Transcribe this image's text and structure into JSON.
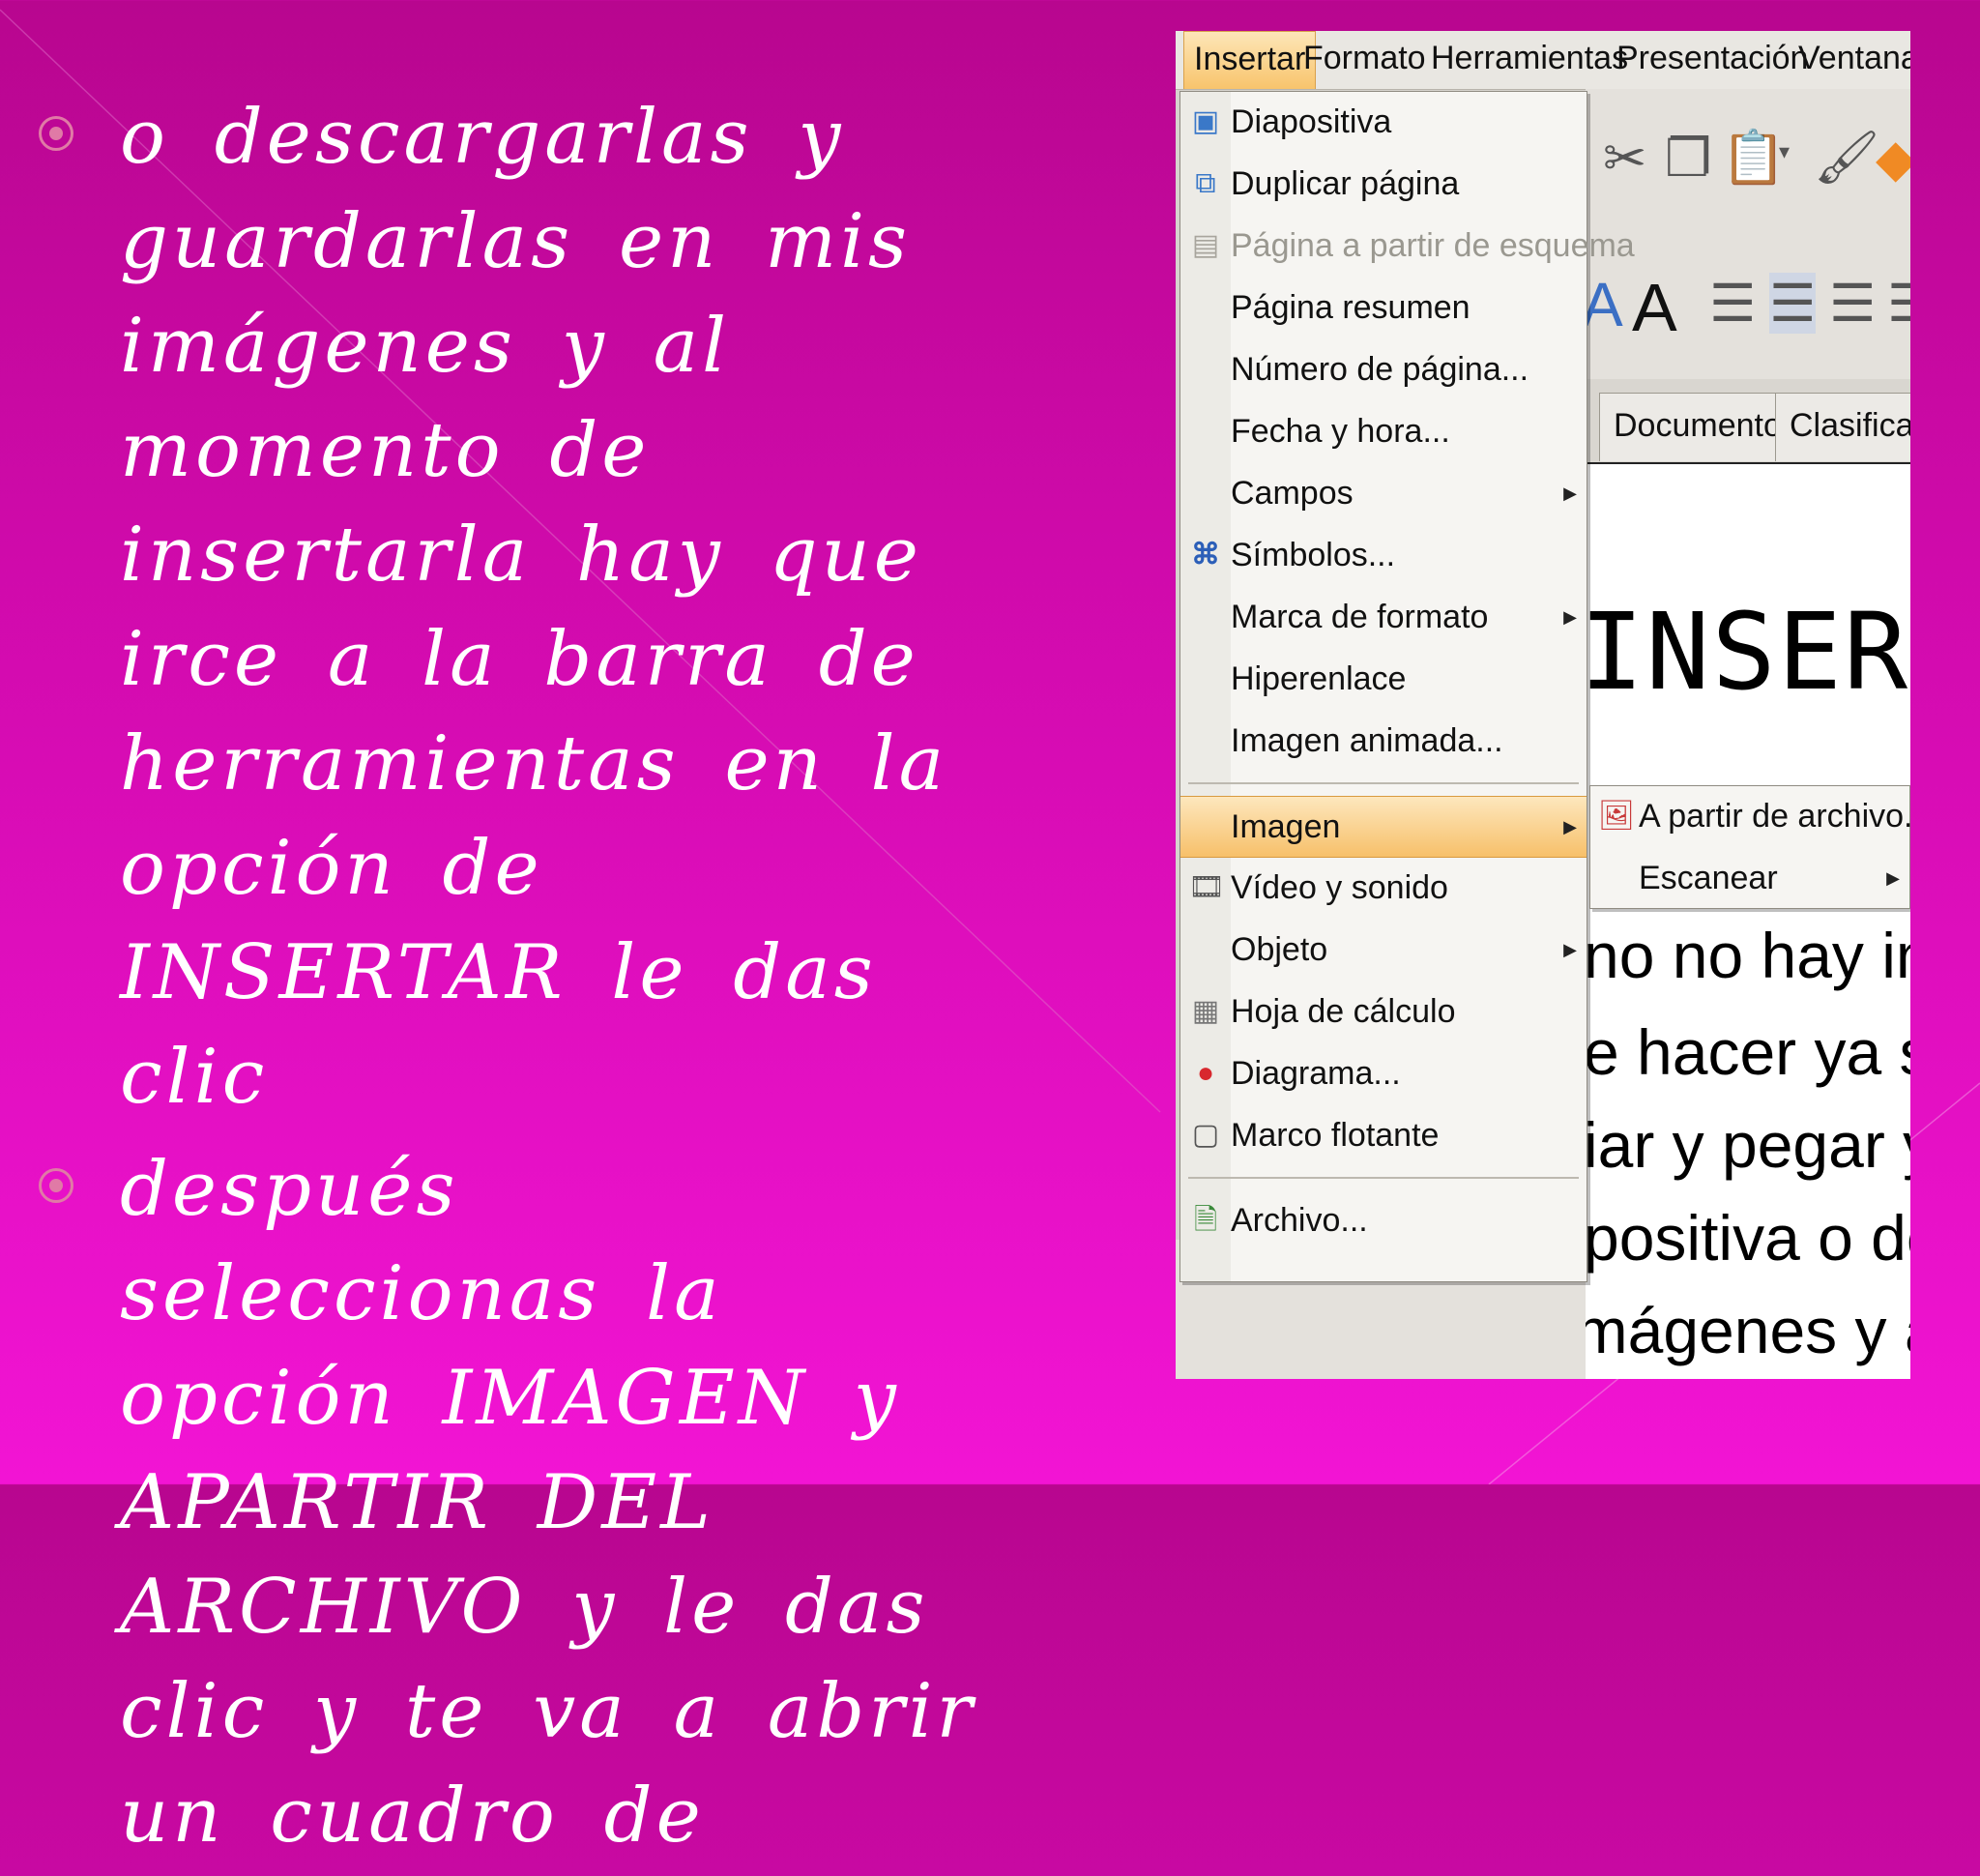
{
  "slide": {
    "bullets": [
      {
        "text": "o descargarlas y guardarlas en mis imágenes y al momento de insertarla hay que irce a la barra de herramientas en la opción de INSERTAR le das clic"
      },
      {
        "text": "después seleccionas la opción IMAGEN y APARTIR DEL ARCHIVO y le das clic y te va a abrir un cuadro de"
      }
    ]
  },
  "screenshot": {
    "menubar": [
      "Insertar",
      "Formato",
      "Herramientas",
      "Presentación",
      "Ventana"
    ],
    "active_menu": "Insertar",
    "tabs": [
      "Documento",
      "Clasificac"
    ],
    "document": {
      "heading": "INSERCIÓ",
      "lines": [
        "no no hay imáge",
        "e hacer ya sea l",
        "iar y pegar y as",
        "positiva o desca",
        "imágenes y al mome"
      ]
    },
    "insert_menu": {
      "items": [
        {
          "label": "Diapositiva",
          "icon": "slide-icon"
        },
        {
          "label": "Duplicar página",
          "icon": "duplicate-page-icon"
        },
        {
          "label": "Página a partir de esquema",
          "icon": "outline-page-icon",
          "disabled": true
        },
        {
          "label": "Página resumen"
        },
        {
          "label": "Número de página..."
        },
        {
          "label": "Fecha y hora..."
        },
        {
          "label": "Campos",
          "submenu": true
        },
        {
          "label": "Símbolos...",
          "icon": "symbols-icon"
        },
        {
          "label": "Marca de formato",
          "submenu": true
        },
        {
          "label": "Hiperenlace"
        },
        {
          "label": "Imagen animada..."
        },
        {
          "label": "Imagen",
          "submenu": true,
          "highlighted": true
        },
        {
          "label": "Vídeo y sonido",
          "icon": "video-sound-icon"
        },
        {
          "label": "Objeto",
          "submenu": true
        },
        {
          "label": "Hoja de cálculo",
          "icon": "spreadsheet-icon"
        },
        {
          "label": "Diagrama...",
          "icon": "chart-icon"
        },
        {
          "label": "Marco flotante",
          "icon": "floating-frame-icon"
        },
        {
          "label": "Archivo...",
          "icon": "file-icon"
        }
      ]
    },
    "image_submenu": {
      "items": [
        {
          "label": "A partir de archivo...",
          "icon": "image-from-file-icon"
        },
        {
          "label": "Escanear",
          "submenu": true
        }
      ]
    },
    "colors": {
      "menu_highlight": "#f8c46c",
      "slide_bg_top": "#b8068f",
      "slide_bg_bottom": "#f214d4"
    }
  }
}
